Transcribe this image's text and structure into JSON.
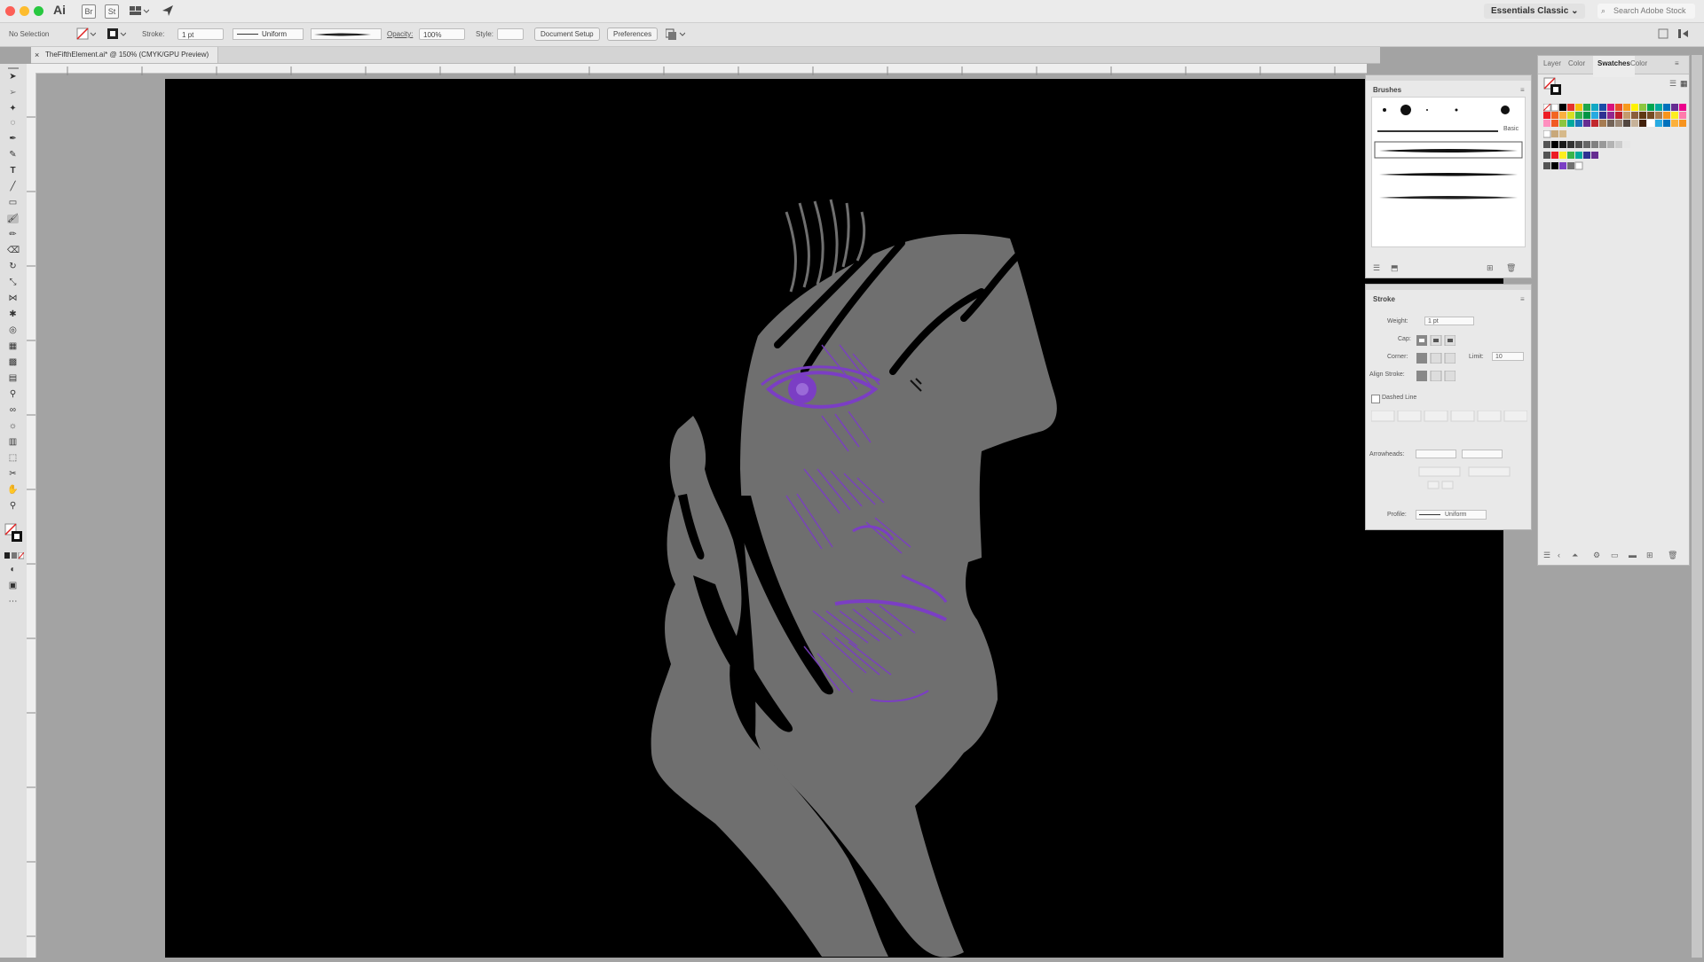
{
  "app": {
    "logo": "Ai",
    "icons": [
      "Br",
      "St"
    ],
    "workspace": "Essentials Classic",
    "search_placeholder": "Search Adobe Stock"
  },
  "control_bar": {
    "selection_status": "No Selection",
    "stroke_label": "Stroke:",
    "stroke_weight": "1 pt",
    "profile": "Uniform",
    "opacity_label": "Opacity:",
    "opacity_value": "100%",
    "style_label": "Style:",
    "document_setup": "Document Setup",
    "preferences": "Preferences"
  },
  "document": {
    "tab_title": "TheFifthElement.ai* @ 150% (CMYK/GPU Preview)"
  },
  "brushes_panel": {
    "title": "Brushes",
    "basic_label": "Basic"
  },
  "stroke_panel": {
    "title": "Stroke",
    "weight_label": "Weight:",
    "weight_value": "1 pt",
    "cap_label": "Cap:",
    "corner_label": "Corner:",
    "limit_label": "Limit:",
    "limit_value": "10",
    "align_label": "Align Stroke:",
    "dashed_label": "Dashed Line",
    "arrowheads_label": "Arrowheads:",
    "profile_label": "Profile:",
    "profile_value": "Uniform"
  },
  "swatches_panel": {
    "tabs": [
      "Layer",
      "Color",
      "Swatches",
      "Color"
    ],
    "active_tab": "Swatches"
  },
  "colors": {
    "accent_purple": "#7b3ec4",
    "face_gray": "#6f6f6f",
    "artboard_black": "#000000"
  }
}
